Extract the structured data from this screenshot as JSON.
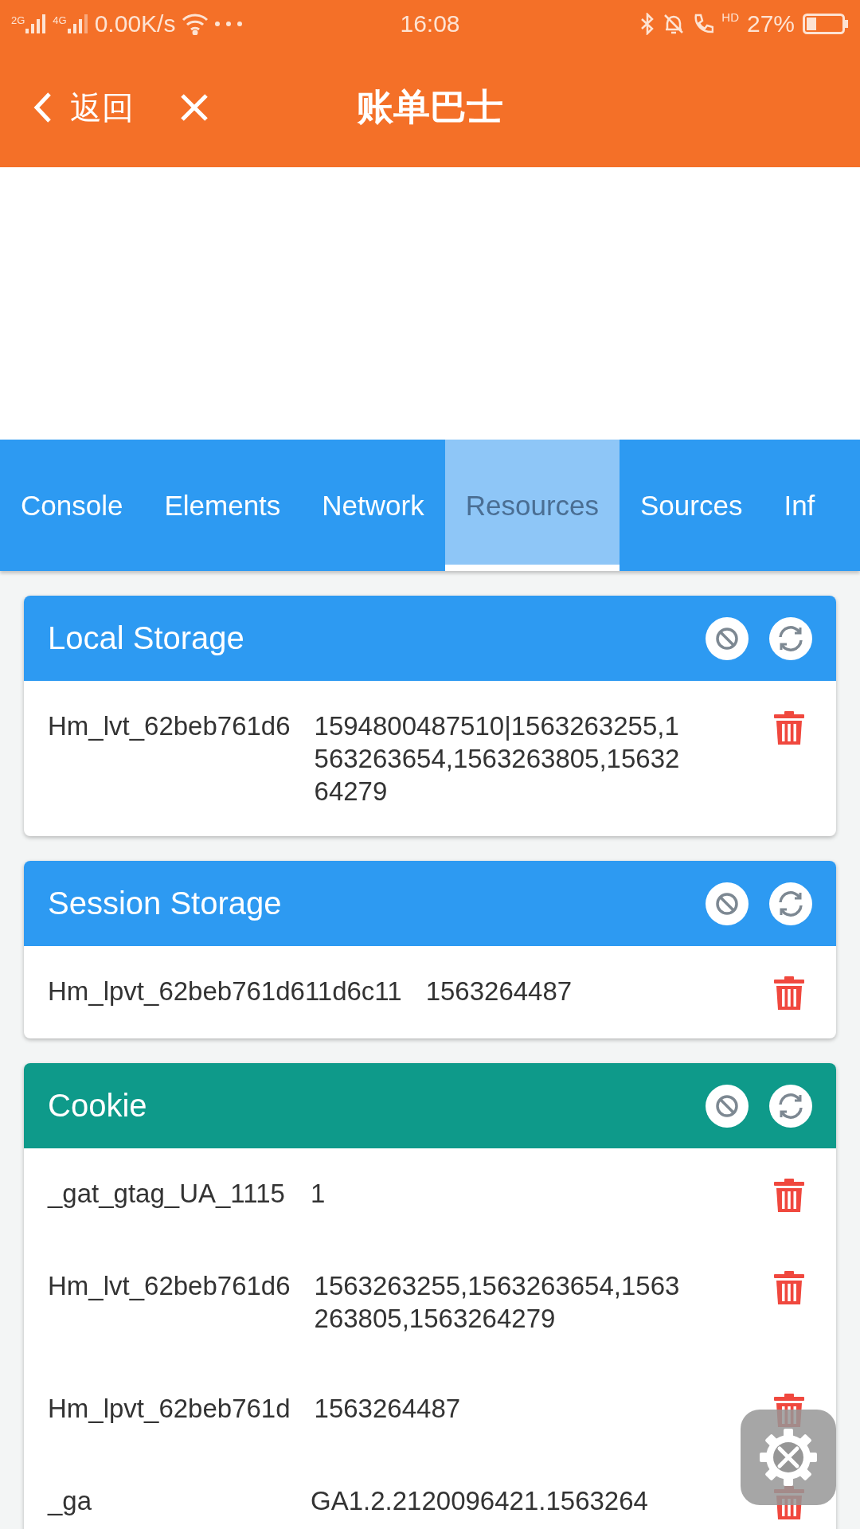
{
  "status_bar": {
    "signal_1": "2G",
    "signal_2": "4G",
    "speed": "0.00K/s",
    "time": "16:08",
    "call_badge": "HD",
    "battery": "27%"
  },
  "nav": {
    "back_label": "返回",
    "title": "账单巴士"
  },
  "tabs": [
    {
      "label": "Console",
      "selected": false
    },
    {
      "label": "Elements",
      "selected": false
    },
    {
      "label": "Network",
      "selected": false
    },
    {
      "label": "Resources",
      "selected": true
    },
    {
      "label": "Sources",
      "selected": false
    },
    {
      "label": "Inf",
      "selected": false
    }
  ],
  "panels": [
    {
      "title": "Local Storage",
      "color": "#2d9af2",
      "rows": [
        {
          "key": "Hm_lvt_62beb761d6",
          "value": "1594800487510|1563263255,1563263654,1563263805,1563264279"
        }
      ]
    },
    {
      "title": "Session Storage",
      "color": "#2d9af2",
      "rows": [
        {
          "key": "Hm_lpvt_62beb761d611d6c11",
          "value": "1563264487"
        }
      ]
    },
    {
      "title": "Cookie",
      "color": "#0e9a8a",
      "rows": [
        {
          "key": "_gat_gtag_UA_1115",
          "value": "1"
        },
        {
          "key": "Hm_lvt_62beb761d6",
          "value": "1563263255,1563263654,1563263805,1563264279"
        },
        {
          "key": "Hm_lpvt_62beb761d",
          "value": "1563264487"
        },
        {
          "key": "_ga",
          "value": "GA1.2.2120096421.1563264"
        }
      ]
    }
  ]
}
